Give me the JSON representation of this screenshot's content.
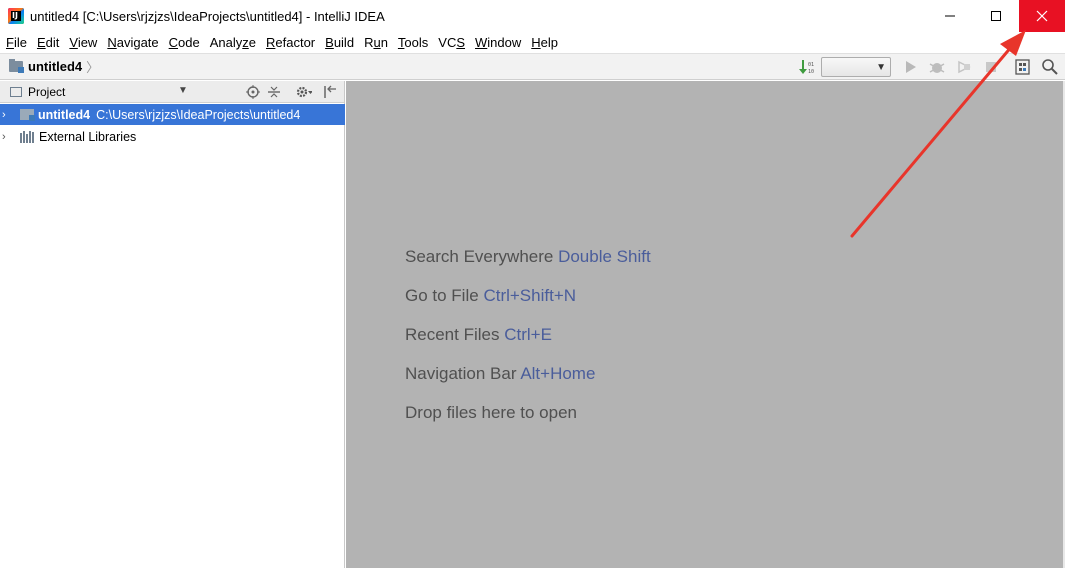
{
  "window": {
    "title": "untitled4 [C:\\Users\\rjzjzs\\IdeaProjects\\untitled4] - IntelliJ IDEA",
    "app_icon": "intellij-idea-icon",
    "controls": [
      "minimize-icon",
      "maximize-icon",
      "close-icon"
    ],
    "close_color": "#e81123"
  },
  "menu": {
    "items": [
      {
        "u": "F",
        "rest": "ile"
      },
      {
        "u": "E",
        "rest": "dit"
      },
      {
        "u": "V",
        "rest": "iew"
      },
      {
        "u": "N",
        "rest": "avigate"
      },
      {
        "u": "C",
        "rest": "ode"
      },
      {
        "pre": "Analy",
        "u": "z",
        "rest": "e"
      },
      {
        "u": "R",
        "rest": "efactor"
      },
      {
        "u": "B",
        "rest": "uild"
      },
      {
        "pre": "R",
        "u": "u",
        "rest": "n"
      },
      {
        "u": "T",
        "rest": "ools"
      },
      {
        "pre": "VC",
        "u": "S",
        "rest": ""
      },
      {
        "u": "W",
        "rest": "indow"
      },
      {
        "u": "H",
        "rest": "elp"
      }
    ]
  },
  "navbar": {
    "breadcrumb": "untitled4",
    "toolbar_icons": [
      "build-project-icon",
      "run-config-select",
      "run-icon",
      "debug-icon",
      "coverage-icon",
      "stop-icon",
      "project-structure-icon",
      "search-icon"
    ]
  },
  "project_panel": {
    "title": "Project",
    "header_icons": [
      "sync-icon",
      "collapse-icon",
      "settings-icon",
      "hide-icon"
    ],
    "tree": [
      {
        "name": "untitled4",
        "path": "C:\\Users\\rjzjzs\\IdeaProjects\\untitled4",
        "selected": true
      },
      {
        "name": "External Libraries",
        "selected": false
      }
    ]
  },
  "editor": {
    "hints": [
      {
        "text": "Search Everywhere",
        "key": "Double Shift"
      },
      {
        "text": "Go to File",
        "key": "Ctrl+Shift+N"
      },
      {
        "text": "Recent Files",
        "key": "Ctrl+E"
      },
      {
        "text": "Navigation Bar",
        "key": "Alt+Home"
      },
      {
        "text": "Drop files here to open",
        "key": ""
      }
    ]
  },
  "colors": {
    "selection": "#3875d7",
    "editor_bg": "#b3b3b3",
    "hint_key": "#4a5d9b",
    "annotation_arrow": "#e8352b"
  }
}
